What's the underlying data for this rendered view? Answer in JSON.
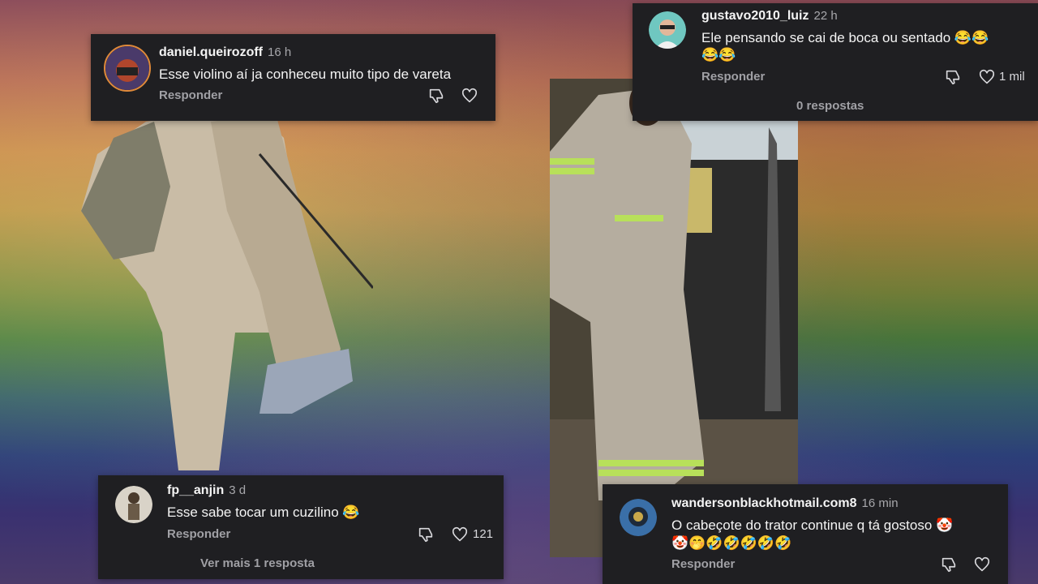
{
  "comments": [
    {
      "user": "daniel.queirozoff",
      "time": "16 h",
      "text": "Esse violino aí ja conheceu muito tipo de vareta",
      "reply_label": "Responder"
    },
    {
      "user": "gustavo2010_luiz",
      "time": "22 h",
      "text_line1": "Ele pensando se cai de boca ou sentado 😂😂",
      "text_line2": "😂😂",
      "reply_label": "Responder",
      "likes": "1 mil",
      "replies_label": "0 respostas"
    },
    {
      "user": "fp__anjin",
      "time": "3 d",
      "text": "Esse sabe tocar um cuzilino 😂",
      "reply_label": "Responder",
      "likes": "121",
      "more_replies": "Ver mais 1 resposta"
    },
    {
      "user": "wandersonblackhotmail.com8",
      "time": "16 min",
      "text_line1": "O cabeçote do trator continue q tá gostoso 🤡",
      "text_line2": "🤡🤭🤣🤣🤣🤣🤣",
      "reply_label": "Responder"
    }
  ],
  "colors": {
    "card_bg": "#1f1f22",
    "text": "#f4f4f4",
    "muted": "#a0a0a5"
  }
}
